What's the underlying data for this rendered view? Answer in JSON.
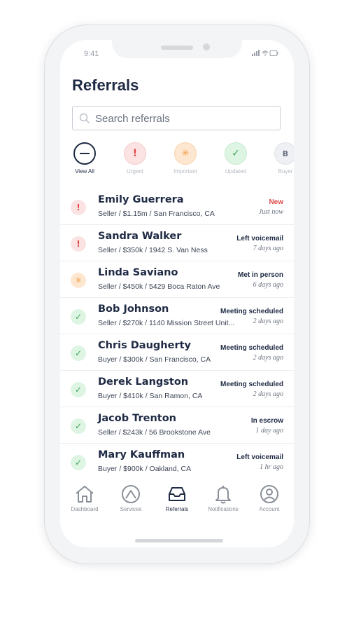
{
  "status_bar": {
    "time": "9:41",
    "icons": "📶 ᯤ ▭"
  },
  "page": {
    "title": "Referrals"
  },
  "search": {
    "placeholder": "Search referrals"
  },
  "filters": [
    {
      "label": "View All",
      "symbol": "–",
      "active": true
    },
    {
      "label": "Urgent",
      "symbol": "!",
      "active": false
    },
    {
      "label": "Important",
      "symbol": "✳",
      "active": false
    },
    {
      "label": "Updated",
      "symbol": "✓",
      "active": false
    },
    {
      "label": "Buyer",
      "symbol": "B",
      "active": false
    }
  ],
  "referrals": [
    {
      "name": "Emily Guerrera",
      "detail": "Seller / $1.15m / San Francisco, CA",
      "status": "New",
      "time": "Just now",
      "type": "urgent"
    },
    {
      "name": "Sandra Walker",
      "detail": "Seller / $350k / 1942 S. Van Ness",
      "status": "Left voicemail",
      "time": "7 days ago",
      "type": "urgent"
    },
    {
      "name": "Linda Saviano",
      "detail": "Seller / $450k / 5429 Boca Raton Ave",
      "status": "Met in person",
      "time": "6 days ago",
      "type": "important"
    },
    {
      "name": "Bob Johnson",
      "detail": "Seller / $270k / 1140 Mission Street Unit...",
      "status": "Meeting scheduled",
      "time": "2 days ago",
      "type": "updated"
    },
    {
      "name": "Chris Daugherty",
      "detail": "Buyer / $300k / San Francisco, CA",
      "status": "Meeting scheduled",
      "time": "2 days ago",
      "type": "updated"
    },
    {
      "name": "Derek Langston",
      "detail": "Buyer / $410k / San Ramon, CA",
      "status": "Meeting scheduled",
      "time": "2 days ago",
      "type": "updated"
    },
    {
      "name": "Jacob Trenton",
      "detail": "Seller / $243k / 56 Brookstone Ave",
      "status": "In escrow",
      "time": "1 day ago",
      "type": "updated"
    },
    {
      "name": "Mary Kauffman",
      "detail": "Buyer / $900k / Oakland, CA",
      "status": "Left voicemail",
      "time": "1 hr ago",
      "type": "updated"
    }
  ],
  "tabs": [
    {
      "label": "Dashboard",
      "icon": "home-icon"
    },
    {
      "label": "Services",
      "icon": "services-icon"
    },
    {
      "label": "Referrals",
      "icon": "inbox-icon",
      "active": true
    },
    {
      "label": "Notifications",
      "icon": "bell-icon"
    },
    {
      "label": "Account",
      "icon": "account-icon"
    }
  ],
  "colors": {
    "urgent": "#e04848",
    "important": "#f0a048",
    "updated": "#3ea55a",
    "text": "#1f2a44"
  }
}
